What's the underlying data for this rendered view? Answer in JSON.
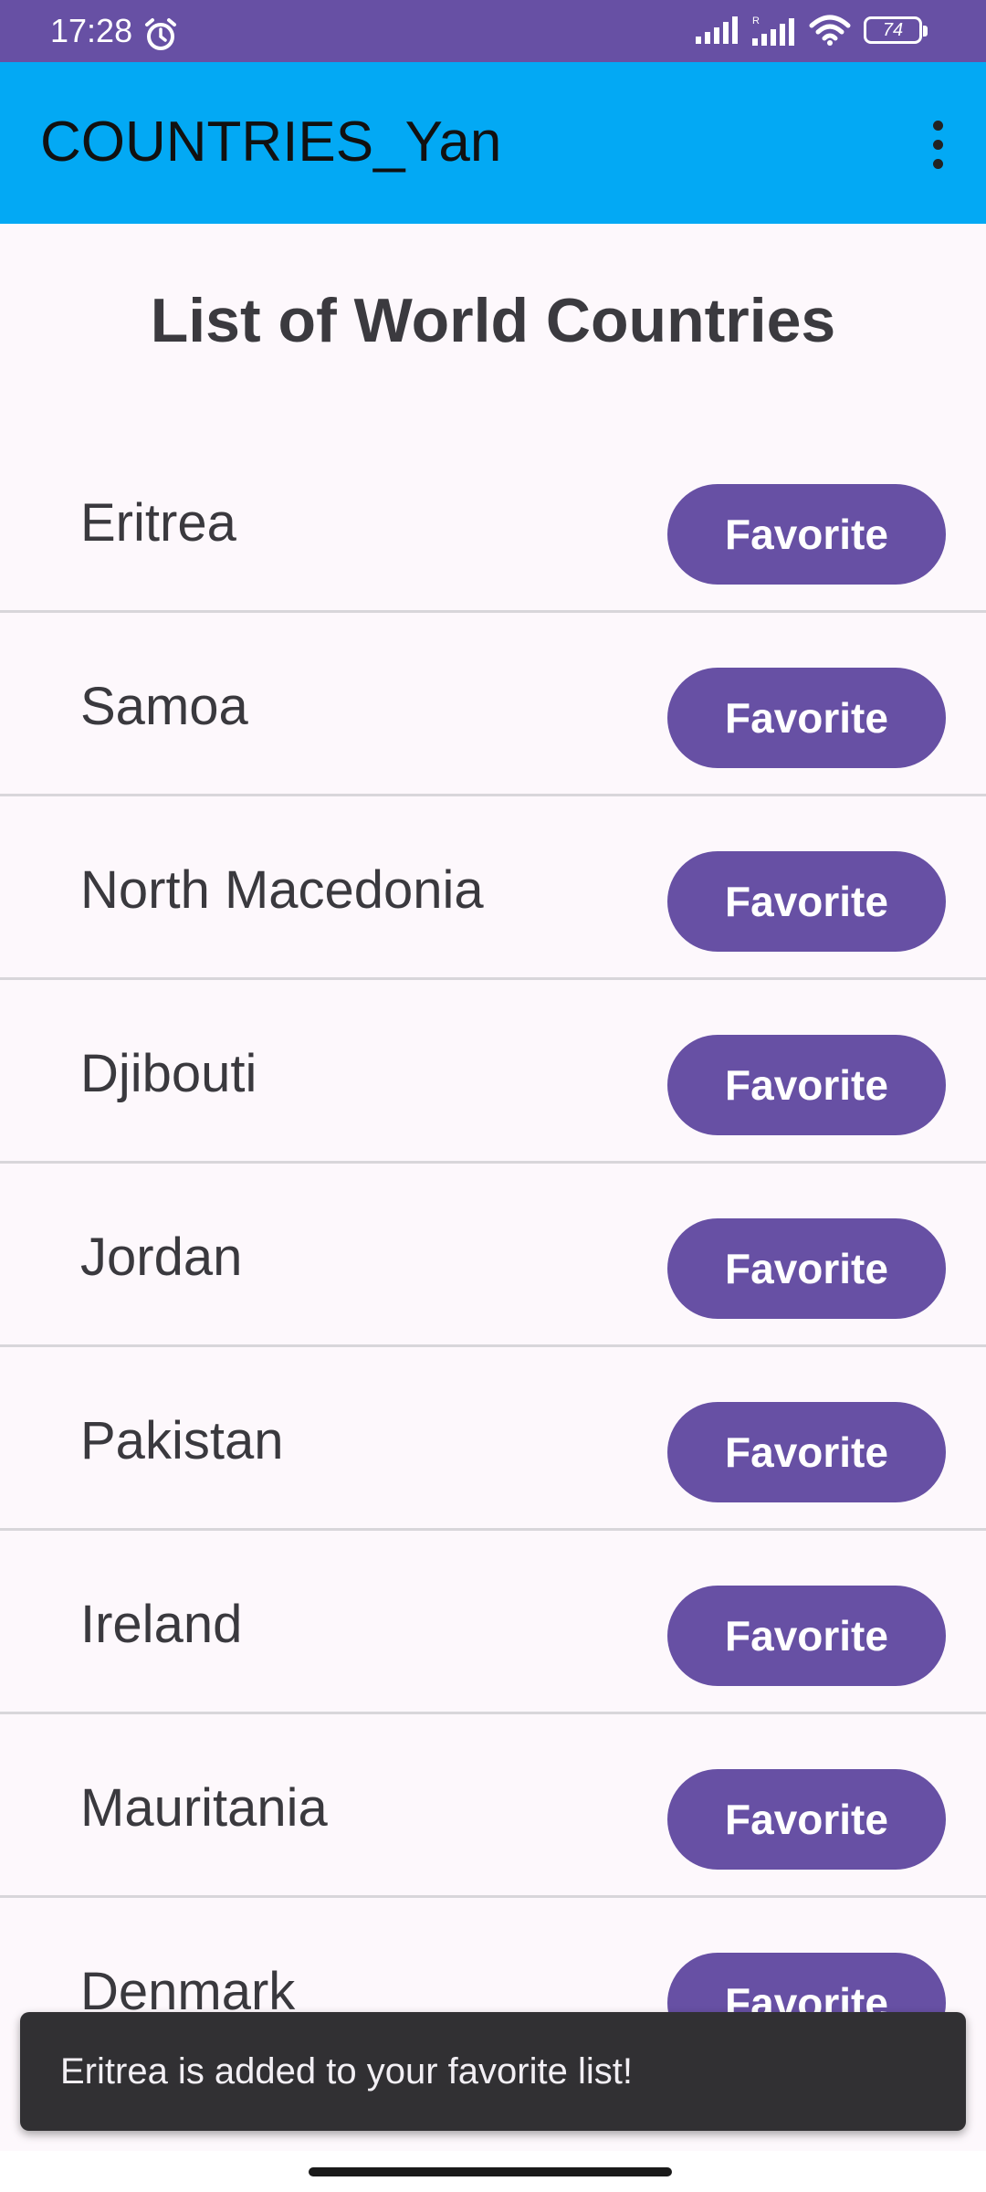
{
  "status_bar": {
    "time": "17:28",
    "battery": "74",
    "icons": [
      "alarm-icon",
      "signal-icon",
      "roaming-signal-icon",
      "wifi-icon",
      "battery-icon"
    ]
  },
  "app_bar": {
    "title": "COUNTRIES_Yan",
    "menu_icon": "more-vert-icon"
  },
  "page": {
    "title": "List of World Countries"
  },
  "countries": [
    {
      "name": "Eritrea",
      "button": "Favorite"
    },
    {
      "name": "Samoa",
      "button": "Favorite"
    },
    {
      "name": "North Macedonia",
      "button": "Favorite"
    },
    {
      "name": "Djibouti",
      "button": "Favorite"
    },
    {
      "name": "Jordan",
      "button": "Favorite"
    },
    {
      "name": "Pakistan",
      "button": "Favorite"
    },
    {
      "name": "Ireland",
      "button": "Favorite"
    },
    {
      "name": "Mauritania",
      "button": "Favorite"
    },
    {
      "name": "Denmark",
      "button": "Favorite"
    }
  ],
  "snackbar": {
    "message": "Eritrea is added to your favorite list!"
  },
  "colors": {
    "status_bar": "#6750a4",
    "app_bar": "#03a9f4",
    "button": "#6750a4",
    "snackbar": "#313033"
  }
}
